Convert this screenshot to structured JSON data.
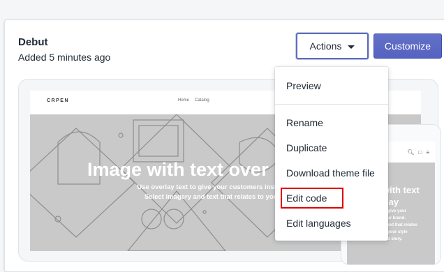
{
  "theme": {
    "name": "Debut",
    "added": "Added 5 minutes ago"
  },
  "buttons": {
    "actions_label": "Actions",
    "customize_label": "Customize"
  },
  "actions_menu": {
    "items": [
      "Preview",
      "Rename",
      "Duplicate",
      "Download theme file",
      "Edit code",
      "Edit languages"
    ],
    "highlighted_item": "Edit code",
    "highlight_color": "#e00000"
  },
  "preview": {
    "store_logo": "CRPEN",
    "nav": [
      "Home",
      "Catalog"
    ],
    "hero_title": "Image with text over",
    "hero_text_line1": "Use overlay text to give your customers insight into you",
    "hero_text_line2": "Select imagery and text that relates to your style an",
    "mobile_hero_title_line1": "with text",
    "mobile_hero_title_line2": "rlay",
    "mobile_text_lines": [
      "to give your",
      "your brand.",
      "d text that relates",
      "to your style",
      "and story."
    ]
  },
  "colors": {
    "accent": "#5c6ac4",
    "text": "#212b36",
    "hero_gray": "#c9c9c9"
  }
}
